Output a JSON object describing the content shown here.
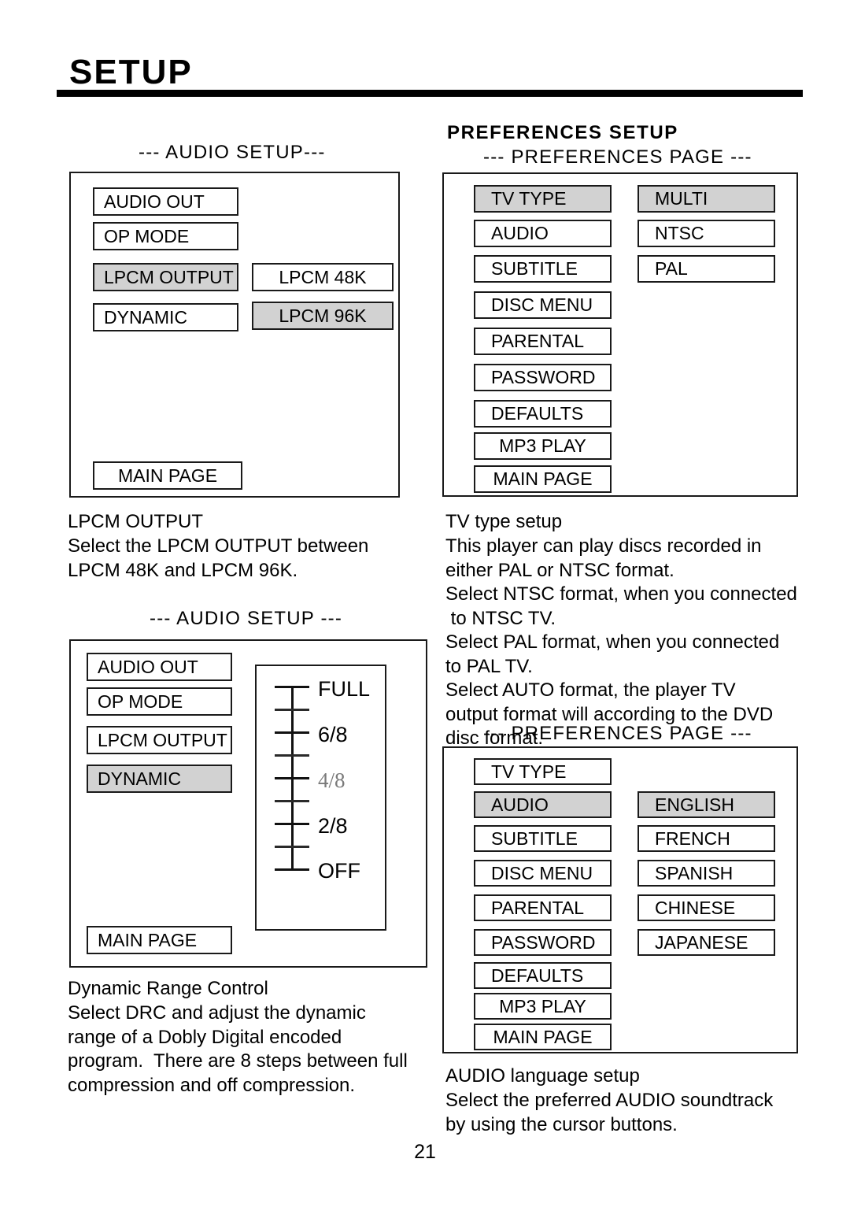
{
  "document": {
    "title": "SETUP",
    "page_number": "21"
  },
  "left_column": {
    "audio_setup_1": {
      "caption": "--- AUDIO SETUP---",
      "menu_items": [
        {
          "label": "AUDIO OUT",
          "selected": false
        },
        {
          "label": "OP MODE",
          "selected": false
        },
        {
          "label": "LPCM OUTPUT",
          "selected": true
        },
        {
          "label": "DYNAMIC",
          "selected": false
        }
      ],
      "submenu_items": [
        {
          "label": "LPCM 48K",
          "selected": false
        },
        {
          "label": "LPCM 96K",
          "selected": true
        }
      ],
      "main_page_label": "MAIN PAGE"
    },
    "lpcm_description": {
      "heading": "LPCM OUTPUT",
      "body": "Select the LPCM OUTPUT between\nLPCM 48K and LPCM 96K."
    },
    "audio_setup_2": {
      "caption": "--- AUDIO SETUP ---",
      "menu_items": [
        {
          "label": "AUDIO OUT",
          "selected": false
        },
        {
          "label": "OP MODE",
          "selected": false
        },
        {
          "label": "LPCM OUTPUT",
          "selected": false
        },
        {
          "label": "DYNAMIC",
          "selected": true
        }
      ],
      "main_page_label": "MAIN PAGE",
      "drc_slider": {
        "ticks": [
          {
            "label": "FULL",
            "major": true,
            "dim": false
          },
          {
            "label": "",
            "major": false,
            "dim": false
          },
          {
            "label": "6/8",
            "major": true,
            "dim": false
          },
          {
            "label": "",
            "major": false,
            "dim": false
          },
          {
            "label": "4/8",
            "major": true,
            "dim": true
          },
          {
            "label": "",
            "major": false,
            "dim": false
          },
          {
            "label": "2/8",
            "major": true,
            "dim": false
          },
          {
            "label": "",
            "major": false,
            "dim": false
          },
          {
            "label": "OFF",
            "major": true,
            "dim": false
          }
        ]
      }
    },
    "drc_description": {
      "heading": "Dynamic Range Control",
      "body": "Select DRC and adjust the dynamic\nrange of a Dobly Digital encoded\nprogram.  There are 8 steps between full\ncompression and off compression."
    }
  },
  "right_column": {
    "section_heading": "PREFERENCES SETUP",
    "preferences_page_1": {
      "caption": "--- PREFERENCES PAGE ---",
      "menu_items": [
        {
          "label": "TV TYPE",
          "selected": true
        },
        {
          "label": "AUDIO",
          "selected": false
        },
        {
          "label": "SUBTITLE",
          "selected": false
        },
        {
          "label": "DISC MENU",
          "selected": false
        },
        {
          "label": "PARENTAL",
          "selected": false
        },
        {
          "label": "PASSWORD",
          "selected": false
        },
        {
          "label": "DEFAULTS",
          "selected": false
        },
        {
          "label": "MP3 PLAY",
          "selected": false
        },
        {
          "label": "MAIN PAGE",
          "selected": false
        }
      ],
      "submenu_items": [
        {
          "label": "MULTI",
          "selected": true
        },
        {
          "label": "NTSC",
          "selected": false
        },
        {
          "label": "PAL",
          "selected": false
        }
      ]
    },
    "tv_type_description": {
      "heading": "TV type setup",
      "body": "This player can play discs recorded in\neither PAL or NTSC format.\nSelect NTSC format, when you connected\n to NTSC TV.\nSelect PAL format, when you connected\nto PAL TV.\nSelect AUTO format, the player TV\noutput format will according to the DVD\ndisc format."
    },
    "preferences_page_2": {
      "caption": "--- PREFERENCES PAGE ---",
      "menu_items": [
        {
          "label": "TV TYPE",
          "selected": false
        },
        {
          "label": "AUDIO",
          "selected": true
        },
        {
          "label": "SUBTITLE",
          "selected": false
        },
        {
          "label": "DISC MENU",
          "selected": false
        },
        {
          "label": "PARENTAL",
          "selected": false
        },
        {
          "label": "PASSWORD",
          "selected": false
        },
        {
          "label": "DEFAULTS",
          "selected": false
        },
        {
          "label": "MP3 PLAY",
          "selected": false
        },
        {
          "label": "MAIN PAGE",
          "selected": false
        }
      ],
      "submenu_items": [
        {
          "label": "ENGLISH",
          "selected": true
        },
        {
          "label": "FRENCH",
          "selected": false
        },
        {
          "label": "SPANISH",
          "selected": false
        },
        {
          "label": "CHINESE",
          "selected": false
        },
        {
          "label": "JAPANESE",
          "selected": false
        }
      ]
    },
    "audio_language_description": {
      "heading": "AUDIO language setup",
      "body": "Select the preferred AUDIO soundtrack\nby using the cursor buttons."
    }
  },
  "colors": {
    "selected_highlight": "#d2d2d2",
    "border": "#1a1a1a",
    "text": "#000000",
    "dim_text": "#7a7a7a"
  }
}
